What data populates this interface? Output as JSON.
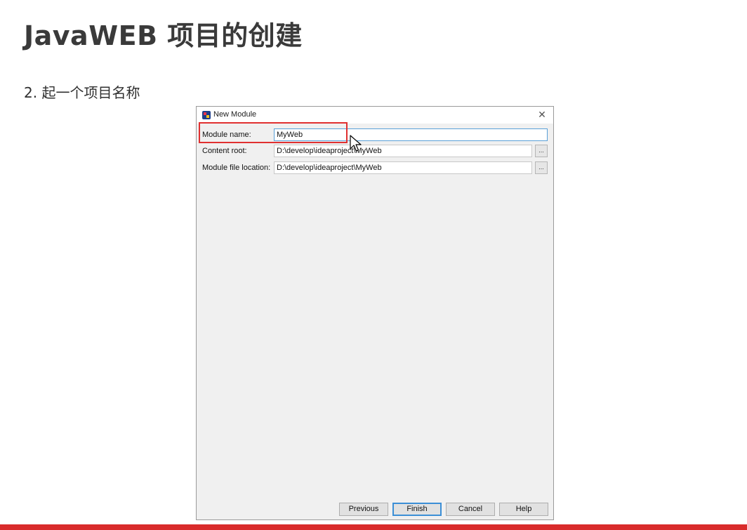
{
  "slide": {
    "title": "JavaWEB 项目的创建",
    "step": "2. 起一个项目名称",
    "accent_color": "#d92b2b"
  },
  "dialog": {
    "title": "New Module",
    "icon": "intellij-idea-icon",
    "close_symbol": "✕",
    "fields": {
      "module_name": {
        "label": "Module name:",
        "value": "MyWeb"
      },
      "content_root": {
        "label": "Content root:",
        "value": "D:\\develop\\ideaproject\\MyWeb"
      },
      "module_file_location": {
        "label": "Module file location:",
        "value": "D:\\develop\\ideaproject\\MyWeb"
      }
    },
    "browse_label": "...",
    "buttons": {
      "previous": "Previous",
      "finish": "Finish",
      "cancel": "Cancel",
      "help": "Help"
    },
    "highlight_color": "#e03030",
    "focus_color": "#5aa0d8"
  }
}
